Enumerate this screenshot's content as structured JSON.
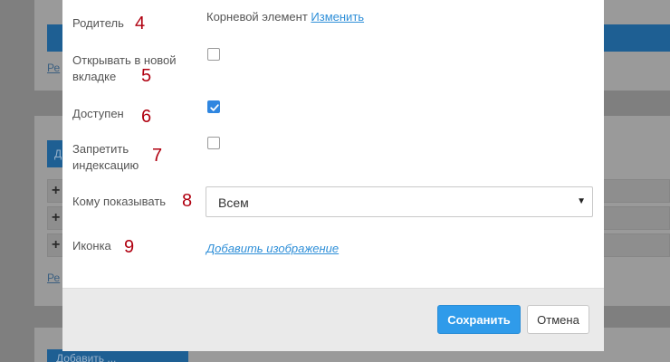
{
  "form": {
    "parent": {
      "label": "Родитель",
      "marker": "4",
      "value": "Корневой элемент",
      "change_link": "Изменить"
    },
    "open_new_tab": {
      "label_line1": "Открывать в новой",
      "label_line2": "вкладке",
      "marker": "5",
      "checked": false
    },
    "available": {
      "label": "Доступен",
      "marker": "6",
      "checked": true
    },
    "noindex": {
      "label_line1": "Запретить",
      "label_line2": "индексацию",
      "marker": "7",
      "checked": false
    },
    "show_to": {
      "label": "Кому показывать",
      "marker": "8",
      "selected": "Всем"
    },
    "icon": {
      "label": "Иконка",
      "marker": "9",
      "add_link": "Добавить изображение"
    }
  },
  "footer": {
    "save_label": "Сохранить",
    "cancel_label": "Отмена"
  },
  "background": {
    "link_1": "Ре",
    "link_2": "Ре",
    "button_partial": "Добавить ...",
    "button_letter": "Д"
  },
  "colors": {
    "accent": "#2f9bea",
    "marker": "#b00010",
    "link": "#2f8fd8",
    "overlay": "#7f7f7f"
  }
}
